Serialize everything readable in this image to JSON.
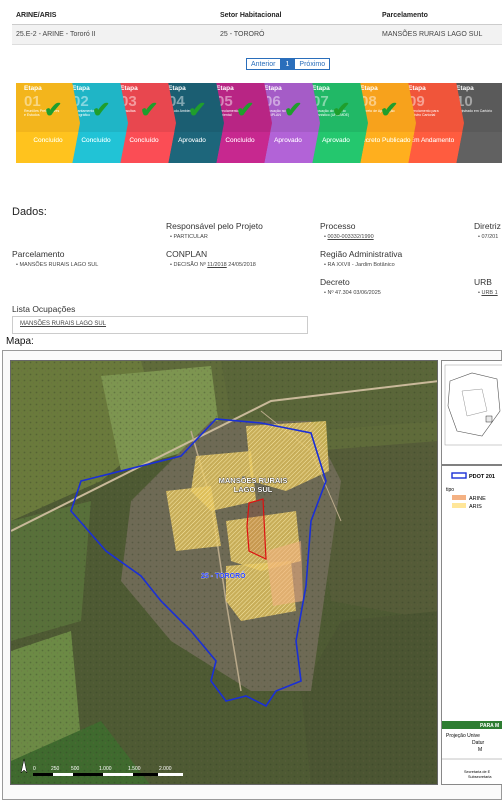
{
  "table": {
    "headers": [
      "ARINE/ARIS",
      "Setor Habitacional",
      "Parcelamento"
    ],
    "row": [
      "25.E-2 - ARINE - Tororó II",
      "25 - TORORÓ",
      "MANSÕES RURAIS LAGO SUL"
    ]
  },
  "pager": {
    "prev": "Anterior",
    "page": "1",
    "next": "Próximo"
  },
  "stages": [
    {
      "tag": "Etapa",
      "num": "01",
      "desc": "Reuniões Preliminares e Estudos",
      "status": "Concluído",
      "color": "#f3b51c",
      "done": true
    },
    {
      "tag": "Etapa",
      "num": "02",
      "desc": "Levantamento Topográfico",
      "status": "Concluído",
      "color": "#1fb5c6",
      "done": true
    },
    {
      "tag": "Etapa",
      "num": "03",
      "desc": "Consultas",
      "status": "Concluído",
      "color": "#e8474f",
      "done": true
    },
    {
      "tag": "Etapa",
      "num": "04",
      "desc": "Estudo Ambiental",
      "status": "Aprovado",
      "color": "#1b5e72",
      "done": true
    },
    {
      "tag": "Etapa",
      "num": "05",
      "desc": "Licenciamento Ambiental",
      "status": "Concluído",
      "color": "#b82584",
      "done": true
    },
    {
      "tag": "Etapa",
      "num": "06",
      "desc": "Aprovação no CONPLAN",
      "status": "Aprovado",
      "color": "#a55cc7",
      "done": true
    },
    {
      "tag": "Etapa",
      "num": "07",
      "desc": "Aprovação do Projeto Urbanístico (URB/MDE)",
      "status": "Aprovado",
      "color": "#21b866",
      "done": true
    },
    {
      "tag": "Etapa",
      "num": "08",
      "desc": "Decreto de Aprovação",
      "status": "Decreto Publicado",
      "color": "#f7a21c",
      "done": true
    },
    {
      "tag": "Etapa",
      "num": "09",
      "desc": "Licenciamento para Registro Cartorial",
      "status": "Em Andamento",
      "color": "#f0553a",
      "done": false
    },
    {
      "tag": "Etapa",
      "num": "10",
      "desc": "Registrado em Cartório",
      "status": "",
      "color": "#5a5a5a",
      "done": false
    }
  ],
  "dados": {
    "title": "Dados:",
    "responsavel_label": "Responsável pelo Projeto",
    "responsavel_value": "PARTICULAR",
    "processo_label": "Processo",
    "processo_value": "0030-003332/1990",
    "diretriz_label": "Diretriz",
    "diretriz_value": "07/201",
    "parcelamento_label": "Parcelamento",
    "parcelamento_value": "MANSÕES RURAIS LAGO SUL",
    "conplan_label": "CONPLAN",
    "conplan_prefix": "DECISÃO Nº",
    "conplan_link": "11/2018",
    "conplan_date": "24/05/2018",
    "regiao_label": "Região Administrativa",
    "regiao_value": "RA XXVII - Jardim Botânico",
    "decreto_label": "Decreto",
    "decreto_value": "Nº 47.304 03/06/2025",
    "urb_label": "URB",
    "urb_value": "URB 1",
    "ocupacoes_label": "Lista Ocupações",
    "ocupacoes_value": "MANSÕES RURAIS LAGO SUL"
  },
  "mapa": {
    "title": "Mapa:",
    "place_label_1": "MANSÕES RURAIS",
    "place_label_2": "LAGO SUL",
    "sector_label": "25 - TORORÓ",
    "scale_labels": [
      "0",
      "250",
      "500",
      "1.000",
      "1.500",
      "2.000"
    ],
    "legend_pdot": "PDOT 201",
    "legend_tipo": "tipo",
    "legend_arine": "ARINE",
    "legend_aris": "ARIS",
    "legend_para": "PARA M",
    "legend_proj1": "Projeção Unive",
    "legend_proj2": "Datur",
    "legend_proj3": "M",
    "legend_sec1": "Secretaria de E",
    "legend_sec2": "Subsecretaria",
    "colors": {
      "arine": "#f4b183",
      "aris": "#ffe699",
      "boundary": "#1a2fd6",
      "pdot": "#1a2fd6"
    }
  }
}
